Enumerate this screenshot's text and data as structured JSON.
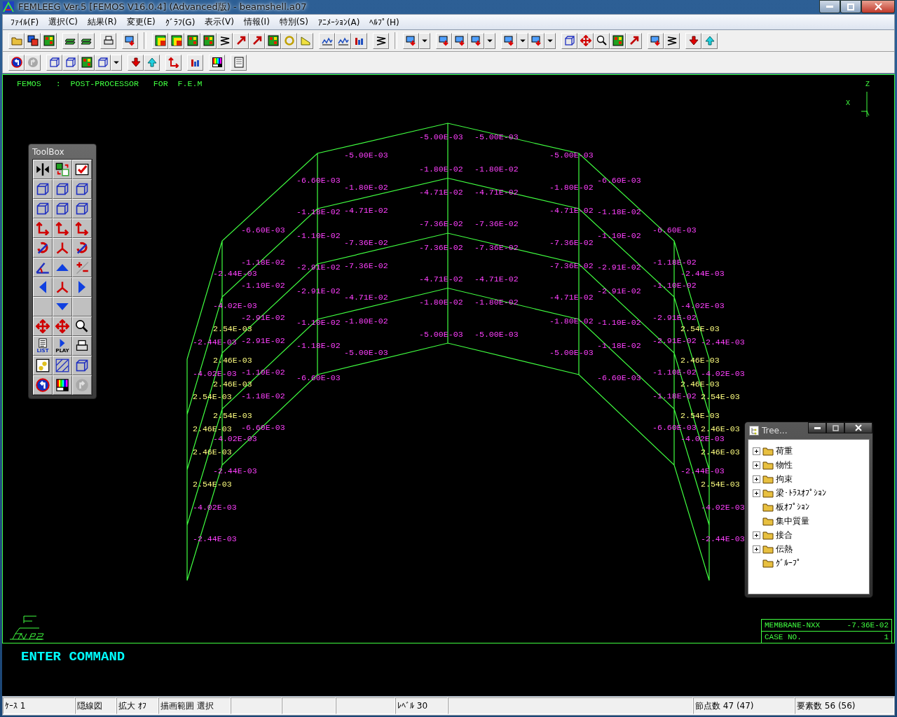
{
  "window": {
    "title": "FEMLEEG Ver.5 [FEMOS V16.0.4] (Advanced版) - beamshell.a07"
  },
  "menu": [
    "ﾌｧｲﾙ(F)",
    "選択(C)",
    "結果(R)",
    "変更(E)",
    "ｸﾞﾗﾌ(G)",
    "表示(V)",
    "情報(I)",
    "特別(S)",
    "ｱﾆﾒｰｼｮﾝ(A)",
    "ﾍﾙﾌﾟ(H)"
  ],
  "toolbox": {
    "title": "ToolBox",
    "list_label": "LIST",
    "play_label": "PLAY"
  },
  "viewport": {
    "header": "FEMOS   :  POST-PROCESSOR   FOR  F.E.M",
    "axis_labels": [
      "Z",
      "X"
    ],
    "labels": [
      {
        "text": "-5.00E-03",
        "color": "#ff40ff"
      },
      {
        "text": "-5.00E-03",
        "color": "#ff40ff"
      },
      {
        "text": "-5.00E-03",
        "color": "#ff40ff"
      },
      {
        "text": "-5.00E-03",
        "color": "#ff40ff"
      },
      {
        "text": "-1.80E-02",
        "color": "#ff40ff"
      },
      {
        "text": "-1.80E-02",
        "color": "#ff40ff"
      },
      {
        "text": "-6.60E-03",
        "color": "#ff40ff"
      },
      {
        "text": "-6.60E-03",
        "color": "#ff40ff"
      },
      {
        "text": "-1.80E-02",
        "color": "#ff40ff"
      },
      {
        "text": "-1.80E-02",
        "color": "#ff40ff"
      },
      {
        "text": "-4.71E-02",
        "color": "#ff40ff"
      },
      {
        "text": "-4.71E-02",
        "color": "#ff40ff"
      },
      {
        "text": "-1.18E-02",
        "color": "#ff40ff"
      },
      {
        "text": "-4.71E-02",
        "color": "#ff40ff"
      },
      {
        "text": "-4.71E-02",
        "color": "#ff40ff"
      },
      {
        "text": "-1.18E-02",
        "color": "#ff40ff"
      },
      {
        "text": "-7.36E-02",
        "color": "#ff40ff"
      },
      {
        "text": "-7.36E-02",
        "color": "#ff40ff"
      },
      {
        "text": "-6.60E-03",
        "color": "#ff40ff"
      },
      {
        "text": "-6.60E-03",
        "color": "#ff40ff"
      },
      {
        "text": "-1.10E-02",
        "color": "#ff40ff"
      },
      {
        "text": "-1.10E-02",
        "color": "#ff40ff"
      },
      {
        "text": "-7.36E-02",
        "color": "#ff40ff"
      },
      {
        "text": "-7.36E-02",
        "color": "#ff40ff"
      },
      {
        "text": "-7.36E-02",
        "color": "#ff40ff"
      },
      {
        "text": "-7.36E-02",
        "color": "#ff40ff"
      },
      {
        "text": "-1.18E-02",
        "color": "#ff40ff"
      },
      {
        "text": "-2.91E-02",
        "color": "#ff40ff"
      },
      {
        "text": "-7.36E-02",
        "color": "#ff40ff"
      },
      {
        "text": "-7.36E-02",
        "color": "#ff40ff"
      },
      {
        "text": "-2.91E-02",
        "color": "#ff40ff"
      },
      {
        "text": "-1.18E-02",
        "color": "#ff40ff"
      },
      {
        "text": "-2.44E-03",
        "color": "#ff40ff"
      },
      {
        "text": "-2.44E-03",
        "color": "#ff40ff"
      },
      {
        "text": "-4.71E-02",
        "color": "#ff40ff"
      },
      {
        "text": "-4.71E-02",
        "color": "#ff40ff"
      },
      {
        "text": "-1.10E-02",
        "color": "#ff40ff"
      },
      {
        "text": "-1.10E-02",
        "color": "#ff40ff"
      },
      {
        "text": "-2.91E-02",
        "color": "#ff40ff"
      },
      {
        "text": "-2.91E-02",
        "color": "#ff40ff"
      },
      {
        "text": "-4.71E-02",
        "color": "#ff40ff"
      },
      {
        "text": "-4.71E-02",
        "color": "#ff40ff"
      },
      {
        "text": "-4.02E-03",
        "color": "#ff40ff"
      },
      {
        "text": "-1.80E-02",
        "color": "#ff40ff"
      },
      {
        "text": "-1.80E-02",
        "color": "#ff40ff"
      },
      {
        "text": "-4.02E-03",
        "color": "#ff40ff"
      },
      {
        "text": "-2.91E-02",
        "color": "#ff40ff"
      },
      {
        "text": "-1.10E-02",
        "color": "#ff40ff"
      },
      {
        "text": "-1.80E-02",
        "color": "#ff40ff"
      },
      {
        "text": "-1.80E-02",
        "color": "#ff40ff"
      },
      {
        "text": "-1.10E-02",
        "color": "#ff40ff"
      },
      {
        "text": "-2.91E-02",
        "color": "#ff40ff"
      },
      {
        "text": "2.54E-03",
        "color": "#ffff80"
      },
      {
        "text": "2.54E-03",
        "color": "#ffff80"
      },
      {
        "text": "-5.00E-03",
        "color": "#ff40ff"
      },
      {
        "text": "-5.00E-03",
        "color": "#ff40ff"
      },
      {
        "text": "-2.44E-03",
        "color": "#ff40ff"
      },
      {
        "text": "-2.91E-02",
        "color": "#ff40ff"
      },
      {
        "text": "-1.18E-02",
        "color": "#ff40ff"
      },
      {
        "text": "-1.18E-02",
        "color": "#ff40ff"
      },
      {
        "text": "-2.91E-02",
        "color": "#ff40ff"
      },
      {
        "text": "-2.44E-03",
        "color": "#ff40ff"
      },
      {
        "text": "-5.00E-03",
        "color": "#ff40ff"
      },
      {
        "text": "-5.00E-03",
        "color": "#ff40ff"
      },
      {
        "text": "2.46E-03",
        "color": "#ffff80"
      },
      {
        "text": "2.46E-03",
        "color": "#ffff80"
      },
      {
        "text": "-4.02E-03",
        "color": "#ff40ff"
      },
      {
        "text": "-1.10E-02",
        "color": "#ff40ff"
      },
      {
        "text": "-1.10E-02",
        "color": "#ff40ff"
      },
      {
        "text": "-4.02E-03",
        "color": "#ff40ff"
      },
      {
        "text": "-6.60E-03",
        "color": "#ff40ff"
      },
      {
        "text": "-6.60E-03",
        "color": "#ff40ff"
      },
      {
        "text": "2.46E-03",
        "color": "#ffff80"
      },
      {
        "text": "2.46E-03",
        "color": "#ffff80"
      },
      {
        "text": "2.54E-03",
        "color": "#ffff80"
      },
      {
        "text": "-1.18E-02",
        "color": "#ff40ff"
      },
      {
        "text": "-1.18E-02",
        "color": "#ff40ff"
      },
      {
        "text": "2.54E-03",
        "color": "#ffff80"
      },
      {
        "text": "2.54E-03",
        "color": "#ffff80"
      },
      {
        "text": "2.54E-03",
        "color": "#ffff80"
      },
      {
        "text": "2.46E-03",
        "color": "#ffff80"
      },
      {
        "text": "-6.60E-03",
        "color": "#ff40ff"
      },
      {
        "text": "-6.60E-03",
        "color": "#ff40ff"
      },
      {
        "text": "2.46E-03",
        "color": "#ffff80"
      },
      {
        "text": "-4.02E-03",
        "color": "#ff40ff"
      },
      {
        "text": "-4.02E-03",
        "color": "#ff40ff"
      },
      {
        "text": "2.46E-03",
        "color": "#ffff80"
      },
      {
        "text": "2.46E-03",
        "color": "#ffff80"
      },
      {
        "text": "-2.44E-03",
        "color": "#ff40ff"
      },
      {
        "text": "-2.44E-03",
        "color": "#ff40ff"
      },
      {
        "text": "2.54E-03",
        "color": "#ffff80"
      },
      {
        "text": "2.54E-03",
        "color": "#ffff80"
      },
      {
        "text": "-4.02E-03",
        "color": "#ff40ff"
      },
      {
        "text": "-4.02E-03",
        "color": "#ff40ff"
      },
      {
        "text": "-2.44E-03",
        "color": "#ff40ff"
      },
      {
        "text": "-2.44E-03",
        "color": "#ff40ff"
      }
    ],
    "result": {
      "quantity": "MEMBRANE-NXX",
      "value": "-7.36E-02",
      "case_label": "CASE NO.",
      "case": "1"
    }
  },
  "tree_window": {
    "title": "Tree...",
    "items": [
      {
        "label": "荷重",
        "has_children": true
      },
      {
        "label": "物性",
        "has_children": true
      },
      {
        "label": "拘束",
        "has_children": true
      },
      {
        "label": "梁･ﾄﾗｽｵﾌﾟｼｮﾝ",
        "has_children": true
      },
      {
        "label": "板ｵﾌﾟｼｮﾝ",
        "has_children": false
      },
      {
        "label": "集中質量",
        "has_children": false
      },
      {
        "label": "接合",
        "has_children": true
      },
      {
        "label": "伝熱",
        "has_children": true
      },
      {
        "label": "ｸﾞﾙｰﾌﾟ",
        "has_children": false
      }
    ]
  },
  "command": {
    "prompt": "ENTER COMMAND"
  },
  "status_bar": [
    "ｹｰｽ 1",
    "隠線図",
    "拡大 ｵﾌ",
    "描画範囲 選択",
    "ﾚﾍﾞﾙ 30",
    "節点数 47 (47)",
    "要素数 56 (56)"
  ]
}
